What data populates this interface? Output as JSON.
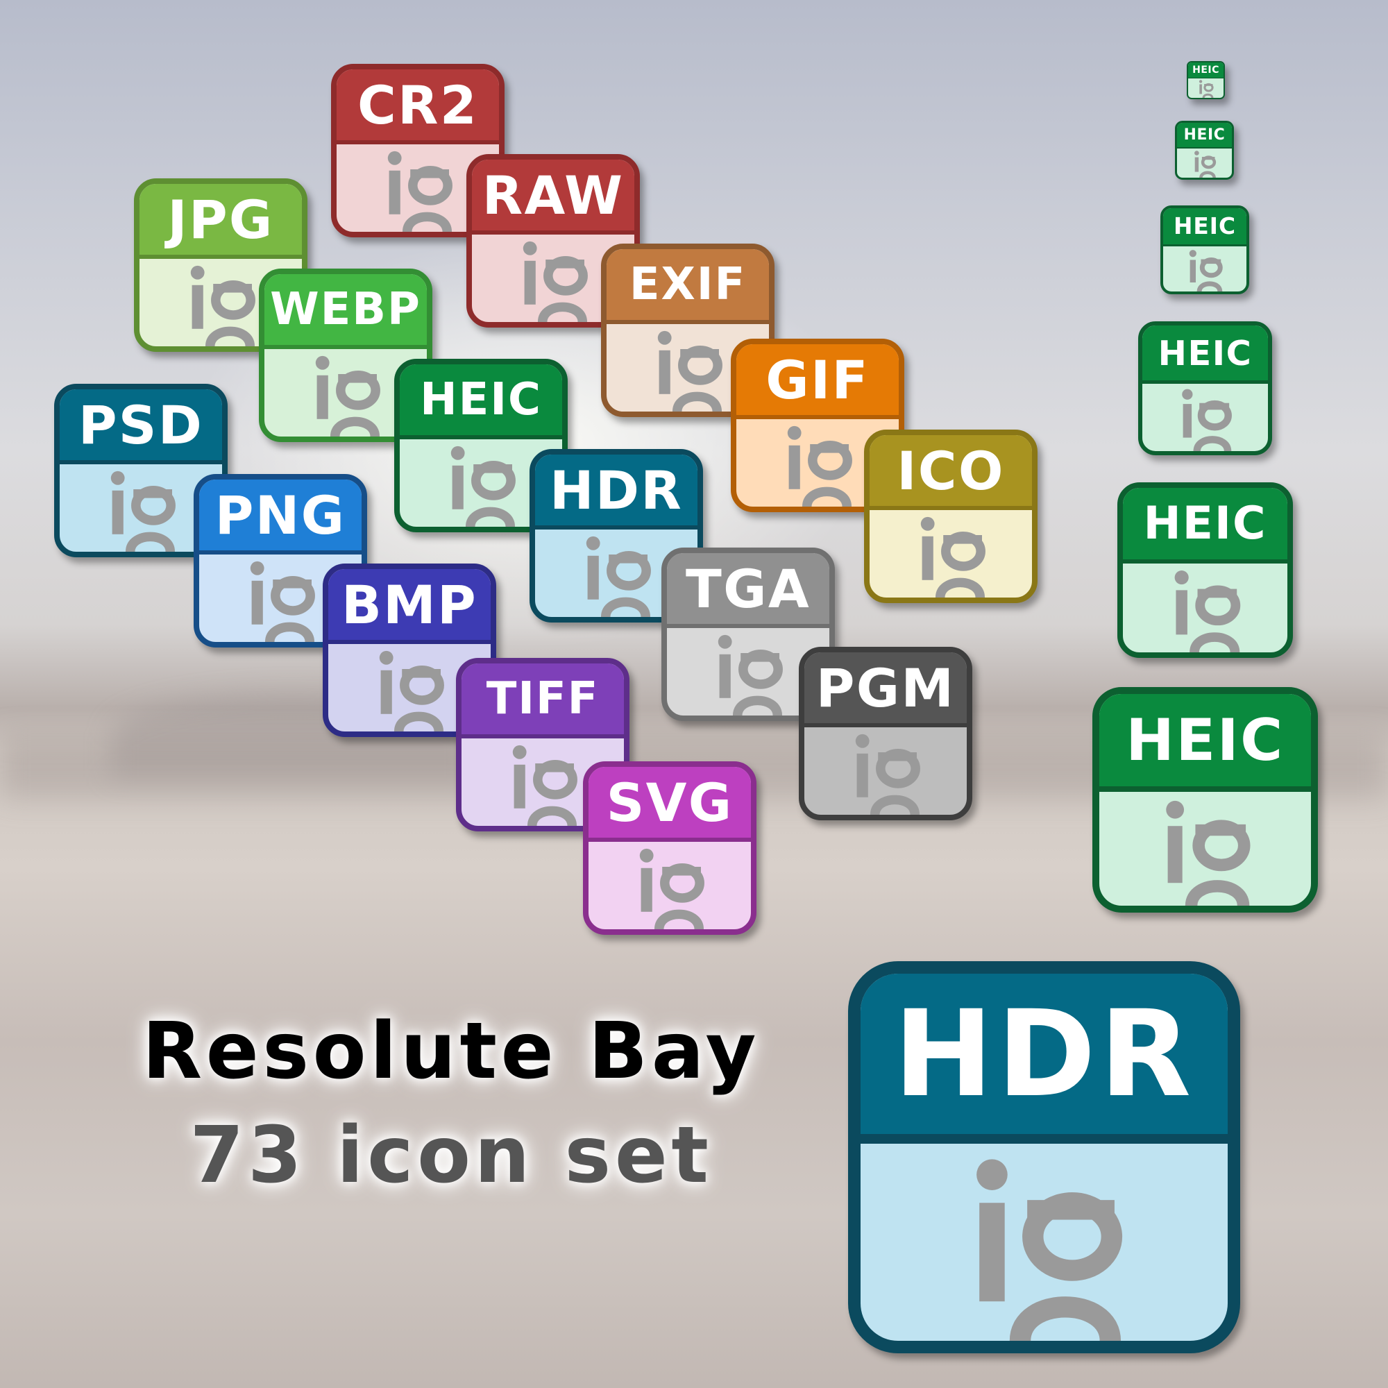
{
  "title": {
    "line1": "Resolute Bay",
    "line2": "73 icon set"
  },
  "icons": [
    {
      "label": "CR2",
      "header": "#b23a3a",
      "border": "#8e2b2b",
      "body": "#f1d4d5"
    },
    {
      "label": "JPG",
      "header": "#7ab843",
      "border": "#5e8f32",
      "body": "#e5f2d6"
    },
    {
      "label": "RAW",
      "header": "#b23a3a",
      "border": "#8e2b2b",
      "body": "#f1d4d5"
    },
    {
      "label": "WEBP",
      "header": "#42b643",
      "border": "#338e34",
      "body": "#d7f1d8"
    },
    {
      "label": "EXIF",
      "header": "#c17a40",
      "border": "#8e5a2f",
      "body": "#f1e2d6"
    },
    {
      "label": "PSD",
      "header": "#046a86",
      "border": "#0b4a5e",
      "body": "#bfe3f1"
    },
    {
      "label": "HEIC",
      "header": "#0a8a3e",
      "border": "#0c6030",
      "body": "#cff0dd"
    },
    {
      "label": "GIF",
      "header": "#e57a05",
      "border": "#b35f06",
      "body": "#ffdcb8"
    },
    {
      "label": "PNG",
      "header": "#1f7fd6",
      "border": "#164e88",
      "body": "#cfe3f8"
    },
    {
      "label": "HDR",
      "header": "#046a86",
      "border": "#0b4a5e",
      "body": "#bfe3f1"
    },
    {
      "label": "ICO",
      "header": "#a89320",
      "border": "#8a7716",
      "body": "#f5f0cd"
    },
    {
      "label": "BMP",
      "header": "#3d3bb3",
      "border": "#2d2c86",
      "body": "#d3d3f0"
    },
    {
      "label": "TGA",
      "header": "#909090",
      "border": "#707070",
      "body": "#d9d9d9"
    },
    {
      "label": "TIFF",
      "header": "#7e40b8",
      "border": "#5e2e8a",
      "body": "#e3d5f2"
    },
    {
      "label": "PGM",
      "header": "#555555",
      "border": "#3e3e3e",
      "body": "#bdbdbd"
    },
    {
      "label": "SVG",
      "header": "#bd40c0",
      "border": "#8a2e8e",
      "body": "#f2d2f2"
    },
    {
      "label": "HEIC",
      "header": "#0a8a3e",
      "border": "#0c6030",
      "body": "#cff0dd"
    },
    {
      "label": "HEIC",
      "header": "#0a8a3e",
      "border": "#0c6030",
      "body": "#cff0dd"
    },
    {
      "label": "HEIC",
      "header": "#0a8a3e",
      "border": "#0c6030",
      "body": "#cff0dd"
    },
    {
      "label": "HEIC",
      "header": "#0a8a3e",
      "border": "#0c6030",
      "body": "#cff0dd"
    },
    {
      "label": "HEIC",
      "header": "#0a8a3e",
      "border": "#0c6030",
      "body": "#cff0dd"
    },
    {
      "label": "HEIC",
      "header": "#0a8a3e",
      "border": "#0c6030",
      "body": "#cff0dd"
    },
    {
      "label": "HDR",
      "header": "#046a86",
      "border": "#0b4a5e",
      "body": "#bfe3f1"
    }
  ]
}
